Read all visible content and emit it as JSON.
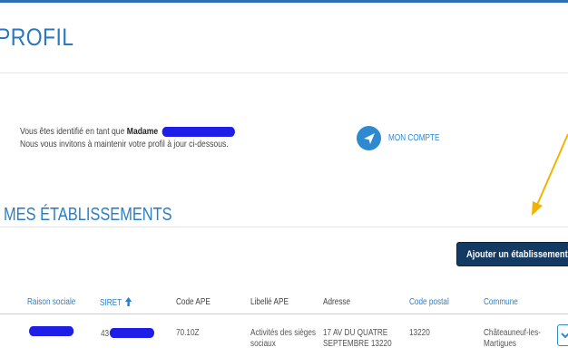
{
  "page": {
    "title": "PROFIL",
    "intro": {
      "line1_prefix": "Vous êtes identifié en tant que",
      "civility": "Madame",
      "line2": "Nous vous invitons à maintenir votre profil à jour ci-dessous."
    },
    "account_link": {
      "label": "MON COMPTE",
      "icon": "send-icon"
    },
    "section_title": "MES ÉTABLISSEMENTS",
    "add_button": "Ajouter un établissement"
  },
  "table": {
    "columns": [
      {
        "key": "raison_sociale",
        "label": "Raison sociale",
        "sortable": true
      },
      {
        "key": "siret",
        "label": "SIRET",
        "sortable": true,
        "sorted": "asc"
      },
      {
        "key": "code_ape",
        "label": "Code APE",
        "sortable": false
      },
      {
        "key": "libelle_ape",
        "label": "Libellé APE",
        "sortable": false
      },
      {
        "key": "adresse",
        "label": "Adresse",
        "sortable": false
      },
      {
        "key": "code_postal",
        "label": "Code postal",
        "sortable": true
      },
      {
        "key": "commune",
        "label": "Commune",
        "sortable": true
      }
    ],
    "rows": [
      {
        "siret_prefix": "43",
        "code_ape": "70.10Z",
        "libelle_ape": [
          "Activités des sièges",
          "sociaux"
        ],
        "adresse": [
          "17 AV DU QUATRE",
          "SEPTEMBRE 13220"
        ],
        "code_postal": "13220",
        "commune": [
          "Châteauneuf-les-",
          "Martigues"
        ]
      }
    ]
  },
  "colors": {
    "accent": "#2b78c2",
    "button": "#123a63",
    "redaction": "#1e1ee6",
    "annotation_arrow": "#f0b400"
  }
}
